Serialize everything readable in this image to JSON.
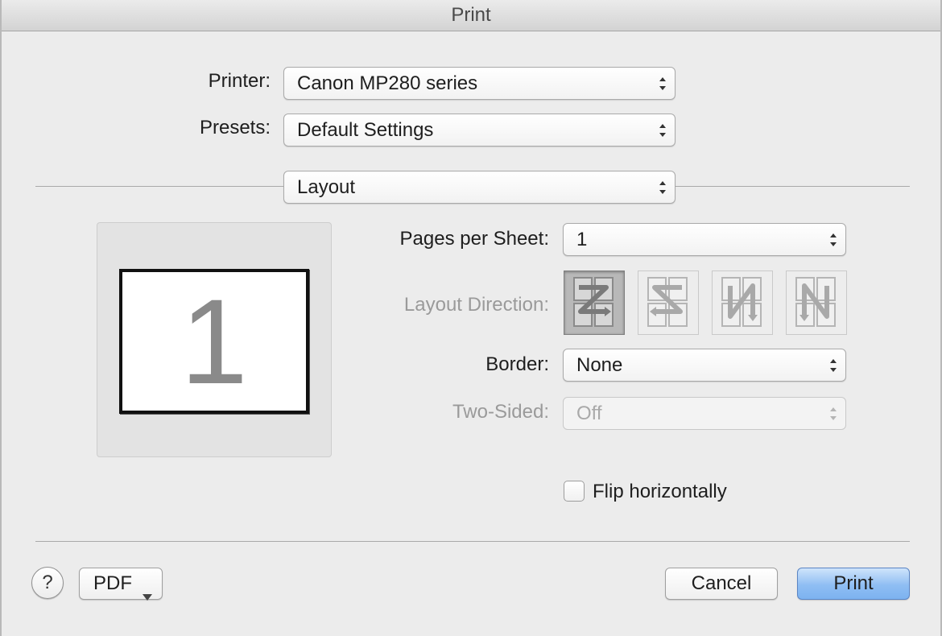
{
  "window": {
    "title": "Print"
  },
  "printer": {
    "label": "Printer:",
    "value": "Canon MP280 series"
  },
  "presets": {
    "label": "Presets:",
    "value": "Default Settings"
  },
  "section": {
    "value": "Layout"
  },
  "layout": {
    "preview_page_number": "1",
    "pages_per_sheet": {
      "label": "Pages per Sheet:",
      "value": "1"
    },
    "layout_direction": {
      "label": "Layout Direction:",
      "options": [
        "z-left-right-icon",
        "s-right-left-icon",
        "n-reverse-top-bottom-icon",
        "n-top-bottom-icon"
      ],
      "selected_index": 0
    },
    "border": {
      "label": "Border:",
      "value": "None"
    },
    "two_sided": {
      "label": "Two-Sided:",
      "value": "Off",
      "enabled": false
    },
    "flip_horizontally": {
      "label": "Flip horizontally",
      "checked": false
    }
  },
  "footer": {
    "help_label": "?",
    "pdf_label": "PDF",
    "cancel_label": "Cancel",
    "print_label": "Print"
  },
  "colors": {
    "dialog_bg": "#ececec",
    "default_button": "#8fbef3",
    "disabled_text": "#9a9a9a"
  }
}
